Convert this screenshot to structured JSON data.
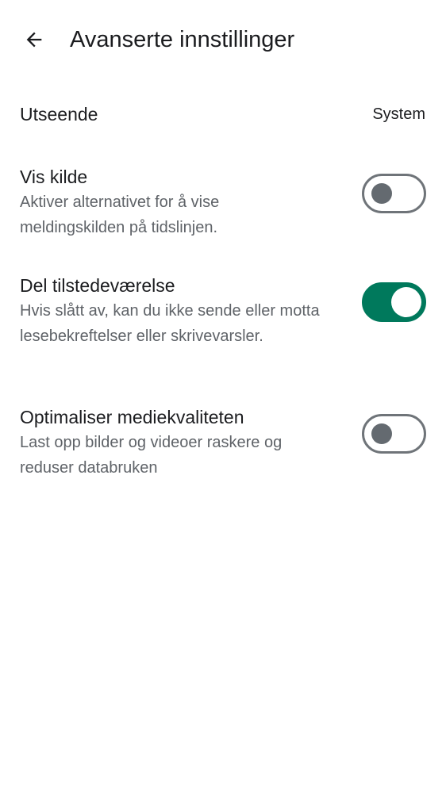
{
  "header": {
    "title": "Avanserte innstillinger",
    "back_icon": "arrow-left-icon"
  },
  "settings": {
    "appearance": {
      "title": "Utseende",
      "value": "System"
    },
    "show_source": {
      "title": "Vis kilde",
      "description": "Aktiver alternativet for å vise meldingskilden på tidslinjen.",
      "enabled": false
    },
    "share_presence": {
      "title": "Del tilstedeværelse",
      "description": "Hvis slått av, kan du ikke sende eller motta lesebekreftelser eller skrivevarsler.",
      "enabled": true
    },
    "optimize_media": {
      "title": "Optimaliser mediekvaliteten",
      "description": "Last opp bilder og videoer raskere og reduser databruken",
      "enabled": false
    }
  },
  "colors": {
    "toggle_on": "#00795c",
    "toggle_off_outline": "#6f7479"
  }
}
